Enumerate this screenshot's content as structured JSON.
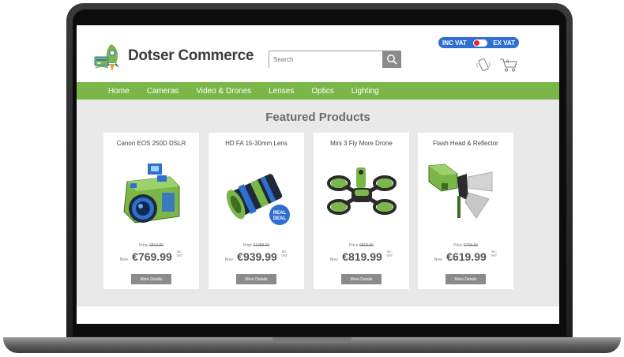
{
  "brand": {
    "name": "Dotser Commerce",
    "logo_icon": "rocket-logo-icon"
  },
  "search": {
    "placeholder": "Search",
    "icon": "search-icon"
  },
  "vat": {
    "inc_label": "INC VAT",
    "ex_label": "EX VAT",
    "accent": "#2f6fd0",
    "knob_color": "#e8262d"
  },
  "header_icons": {
    "phone": "phone-icon",
    "cart": "cart-icon",
    "cart_count": "0"
  },
  "nav": {
    "background": "#7ab648",
    "items": [
      {
        "label": "Home"
      },
      {
        "label": "Cameras"
      },
      {
        "label": "Video & Drones"
      },
      {
        "label": "Lenses"
      },
      {
        "label": "Optics"
      },
      {
        "label": "Lighting"
      }
    ]
  },
  "featured": {
    "title": "Featured Products",
    "products": [
      {
        "name": "Canon EOS 250D DSLR",
        "image": "camera-image",
        "was_label": "Price",
        "was": "€819.80",
        "now_label": "Now",
        "now": "€769.99",
        "vat_line1": "Inc.",
        "vat_line2": "VAT",
        "button": "More Details"
      },
      {
        "name": "HD FA 15-30mm Lens",
        "image": "lens-image",
        "badge_line1": "REAL",
        "badge_line2": "DEAL",
        "was_label": "Price",
        "was": "€1088.00",
        "now_label": "Now",
        "now": "€939.99",
        "vat_line1": "Inc.",
        "vat_line2": "VAT",
        "button": "More Details"
      },
      {
        "name": "Mini 3 Fly More Drone",
        "image": "drone-image",
        "was_label": "Price",
        "was": "€868.80",
        "now_label": "Now",
        "now": "€819.99",
        "vat_line1": "Inc.",
        "vat_line2": "VAT",
        "button": "More Details"
      },
      {
        "name": "Flash Head & Reflector",
        "image": "flash-head-image",
        "was_label": "Price",
        "was": "€798.80",
        "now_label": "Now",
        "now": "€619.99",
        "vat_line1": "Inc.",
        "vat_line2": "VAT",
        "button": "More Details"
      }
    ]
  }
}
